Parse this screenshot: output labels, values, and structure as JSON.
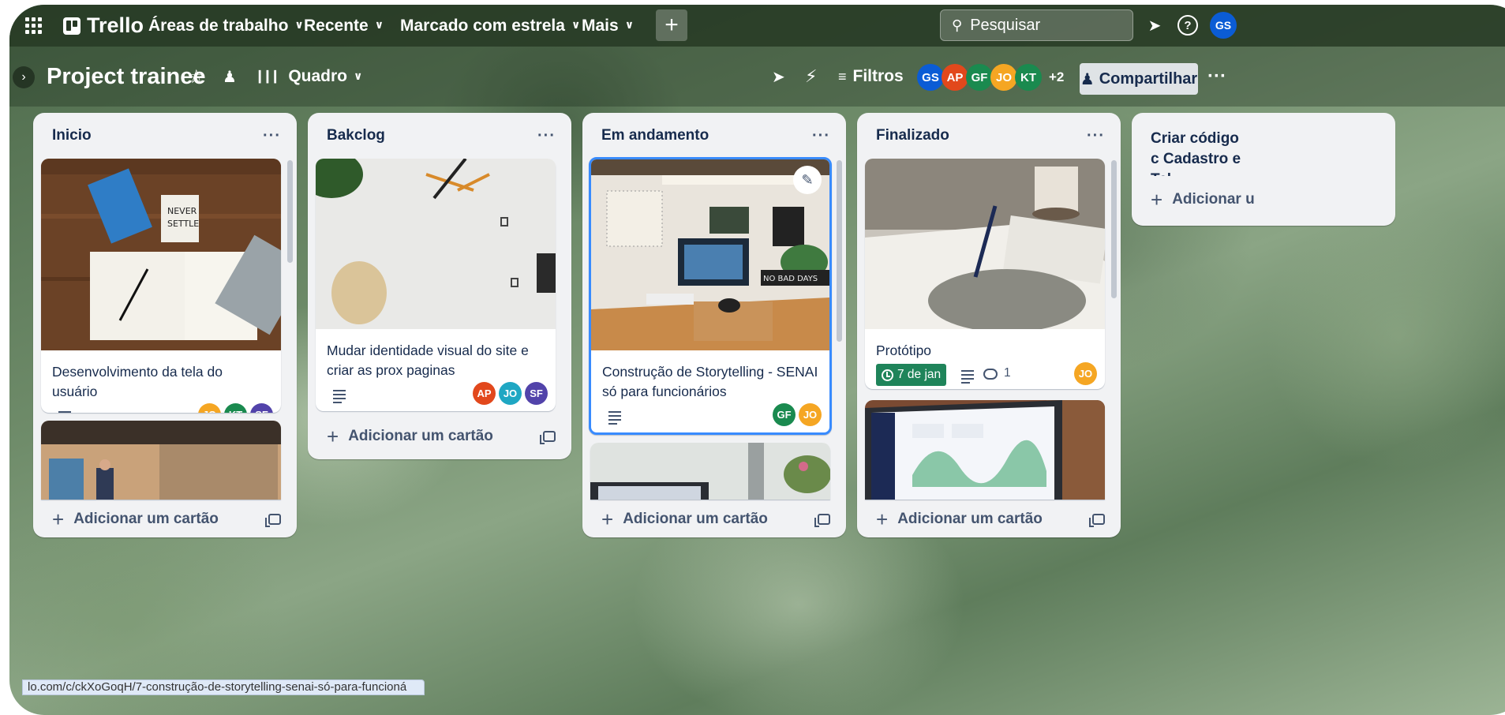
{
  "topnav": {
    "logo": "Trello",
    "workspaces": "Áreas de trabalho",
    "recent": "Recente",
    "starred": "Marcado com estrela",
    "more": "Mais",
    "create": "+",
    "search_placeholder": "Pesquisar",
    "user_initials": "GS"
  },
  "board": {
    "title": "Project trainee",
    "view": "Quadro",
    "filters": "Filtros",
    "members": [
      {
        "initials": "GS",
        "color": "#0b5cd5"
      },
      {
        "initials": "AP",
        "color": "#e2481c"
      },
      {
        "initials": "GF",
        "color": "#1a8a4f"
      },
      {
        "initials": "JO",
        "color": "#f5a623"
      },
      {
        "initials": "KT",
        "color": "#1a8a4f"
      }
    ],
    "members_more": "+2",
    "share": "Compartilhar"
  },
  "lists": [
    {
      "title": "Inicio",
      "cards": [
        {
          "title": "Desenvolvimento da tela do usuário",
          "members": [
            "JO",
            "KT",
            "SF"
          ]
        }
      ],
      "add_card": "Adicionar um cartão"
    },
    {
      "title": "Bakclog",
      "cards": [
        {
          "title": "Mudar identidade visual do site e criar as prox paginas",
          "members": [
            "AP",
            "JO",
            "SF"
          ]
        }
      ],
      "add_card": "Adicionar um cartão"
    },
    {
      "title": "Em andamento",
      "cards": [
        {
          "title": "Construção de Storytelling - SENAI só para funcionários",
          "members": [
            "GF",
            "JO"
          ]
        }
      ],
      "add_card": "Adicionar um cartão"
    },
    {
      "title": "Finalizado",
      "cards": [
        {
          "title": "Protótipo",
          "due": "7 de jan",
          "comments": "1",
          "members": [
            "JO"
          ]
        }
      ],
      "add_card": "Adicionar um cartão"
    },
    {
      "title": "Criar código c Cadastro e Tel",
      "add_card": "Adicionar u"
    }
  ],
  "colors": {
    "JO": "#f5a623",
    "KT": "#1a8a4f",
    "SF": "#5243aa",
    "AP": "#e2481c",
    "GF": "#1a8a4f",
    "GS": "#0b5cd5",
    "accent": "#1f845a",
    "selected_border": "#388bff"
  },
  "icons": {
    "apps": "grid-icon",
    "search": "search-icon",
    "notifications": "megaphone-icon",
    "help": "help-icon",
    "star": "star-icon",
    "visibility": "people-icon",
    "power_ups": "rocket-icon",
    "automation": "lightning-icon",
    "filter": "filter-icon",
    "edit": "pencil-icon",
    "description": "description-icon",
    "clock": "clock-icon",
    "comment": "comment-icon"
  },
  "status_url": "lo.com/c/ckXoGoqH/7-construção-de-storytelling-senai-só-para-funcioná"
}
